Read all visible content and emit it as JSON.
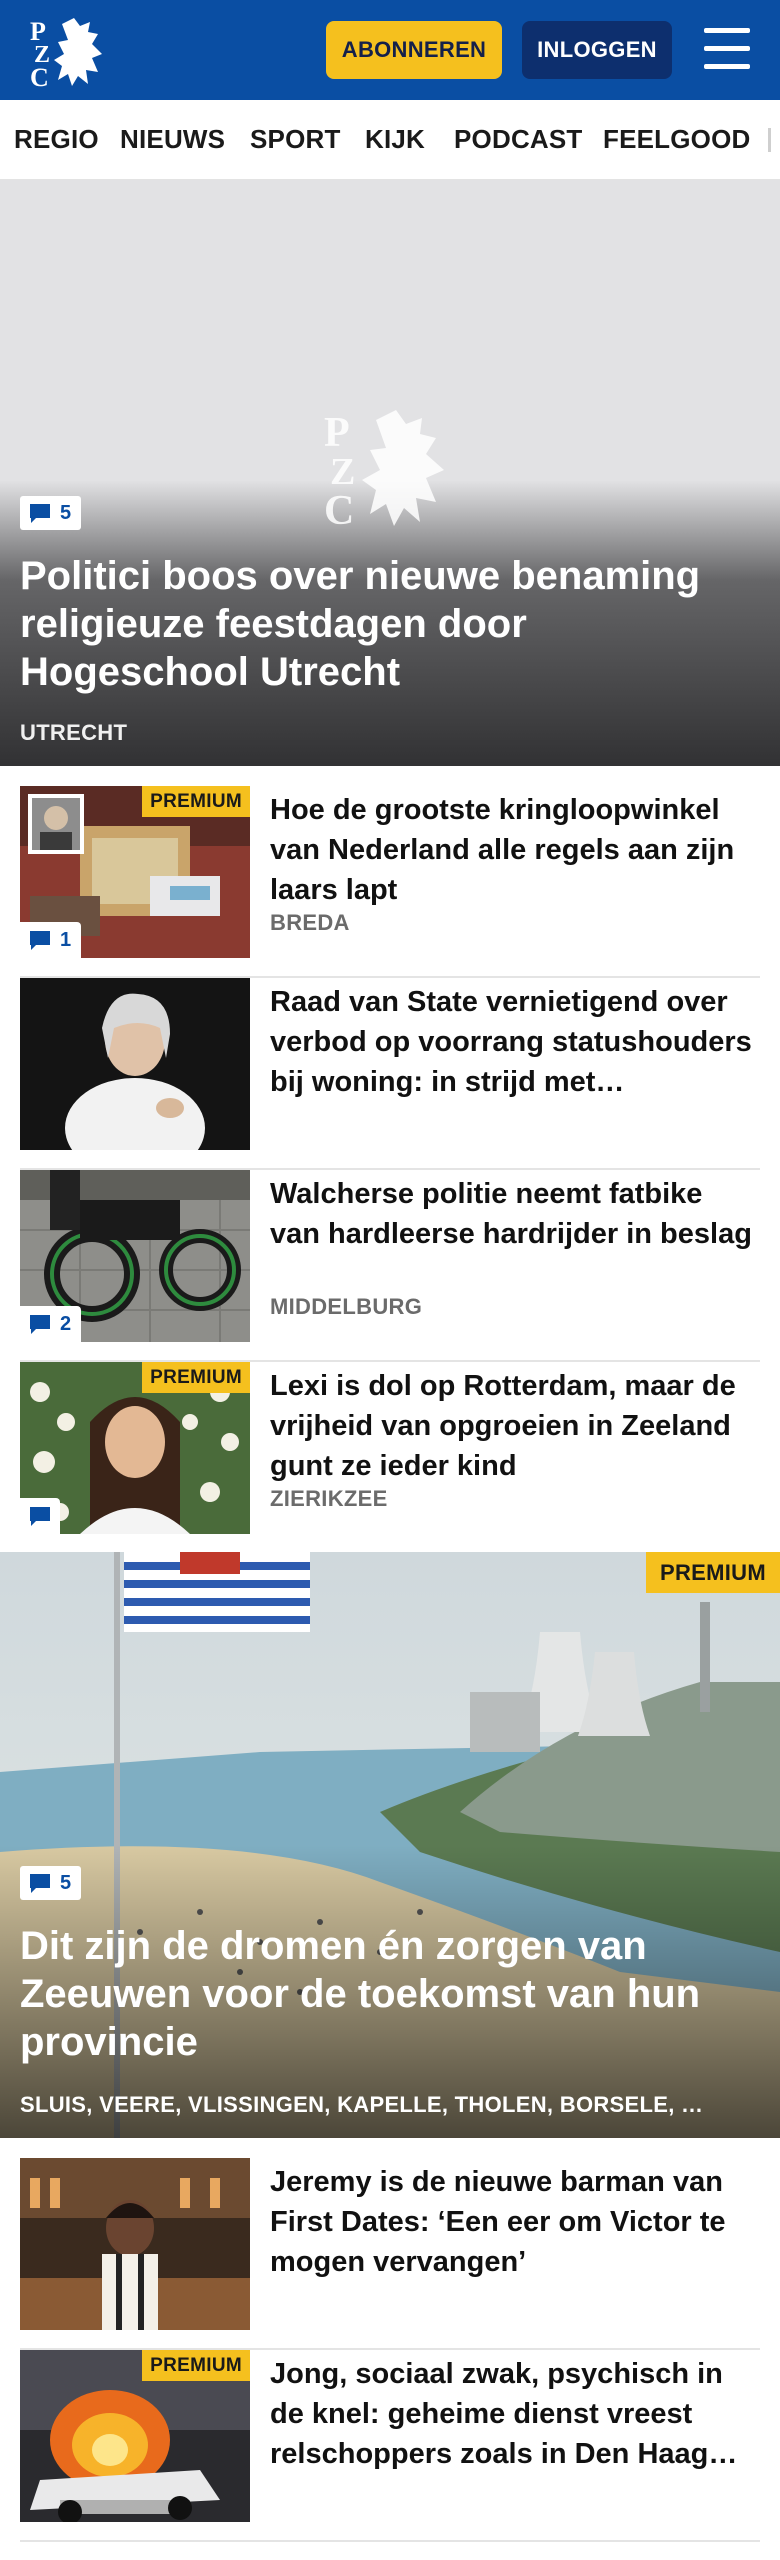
{
  "header": {
    "logo_text": "PZC",
    "subscribe_label": "ABONNEREN",
    "login_label": "INLOGGEN",
    "colors": {
      "brand": "#0a4ea3",
      "accent": "#f5c01e"
    }
  },
  "nav": {
    "items": [
      "REGIO",
      "NIEUWS",
      "SPORT",
      "KIJK",
      "PODCAST",
      "FEELGOOD"
    ]
  },
  "hero": {
    "comments": "5",
    "title": "Politici boos over nieuwe benaming religieuze feestdagen door Hogeschool Utrecht",
    "place": "UTRECHT"
  },
  "articles": [
    {
      "title": "Hoe de grootste kringloopwinkel van Nederland alle regels aan zijn laars lapt",
      "place": "BREDA",
      "premium": "PREMIUM",
      "comments": "1"
    },
    {
      "title": "Raad van State vernietigend over verbod op voorrang statushou­ders bij woning: in strijd met…",
      "place": "",
      "premium": "",
      "comments": ""
    },
    {
      "title": "Walcherse politie neemt fatbike van hardleerse hardrijder in beslag",
      "place": "MIDDELBURG",
      "premium": "",
      "comments": "2"
    },
    {
      "title": "Lexi is dol op Rotterdam, maar de vrijheid van opgroeien in Zeeland gunt ze ieder kind",
      "place": "ZIERIKZEE",
      "premium": "PREMIUM",
      "comments": ""
    }
  ],
  "feature": {
    "premium": "PREMIUM",
    "comments": "5",
    "title": "Dit zijn de dromen én zorgen van Zeeuwen voor de toekomst van hun provincie",
    "place": "SLUIS, VEERE, VLISSINGEN, KAPELLE, THOLEN, BORSELE, …"
  },
  "articles_2": [
    {
      "title": "Jeremy is de nieuwe barman van First Dates: ‘Een eer om Victor te mogen vervangen’",
      "premium": ""
    },
    {
      "title": "Jong, sociaal zwak, psychisch in de knel: geheime dienst vreest relschoppers zoals in Den Haag…",
      "premium": "PREMIUM"
    }
  ]
}
